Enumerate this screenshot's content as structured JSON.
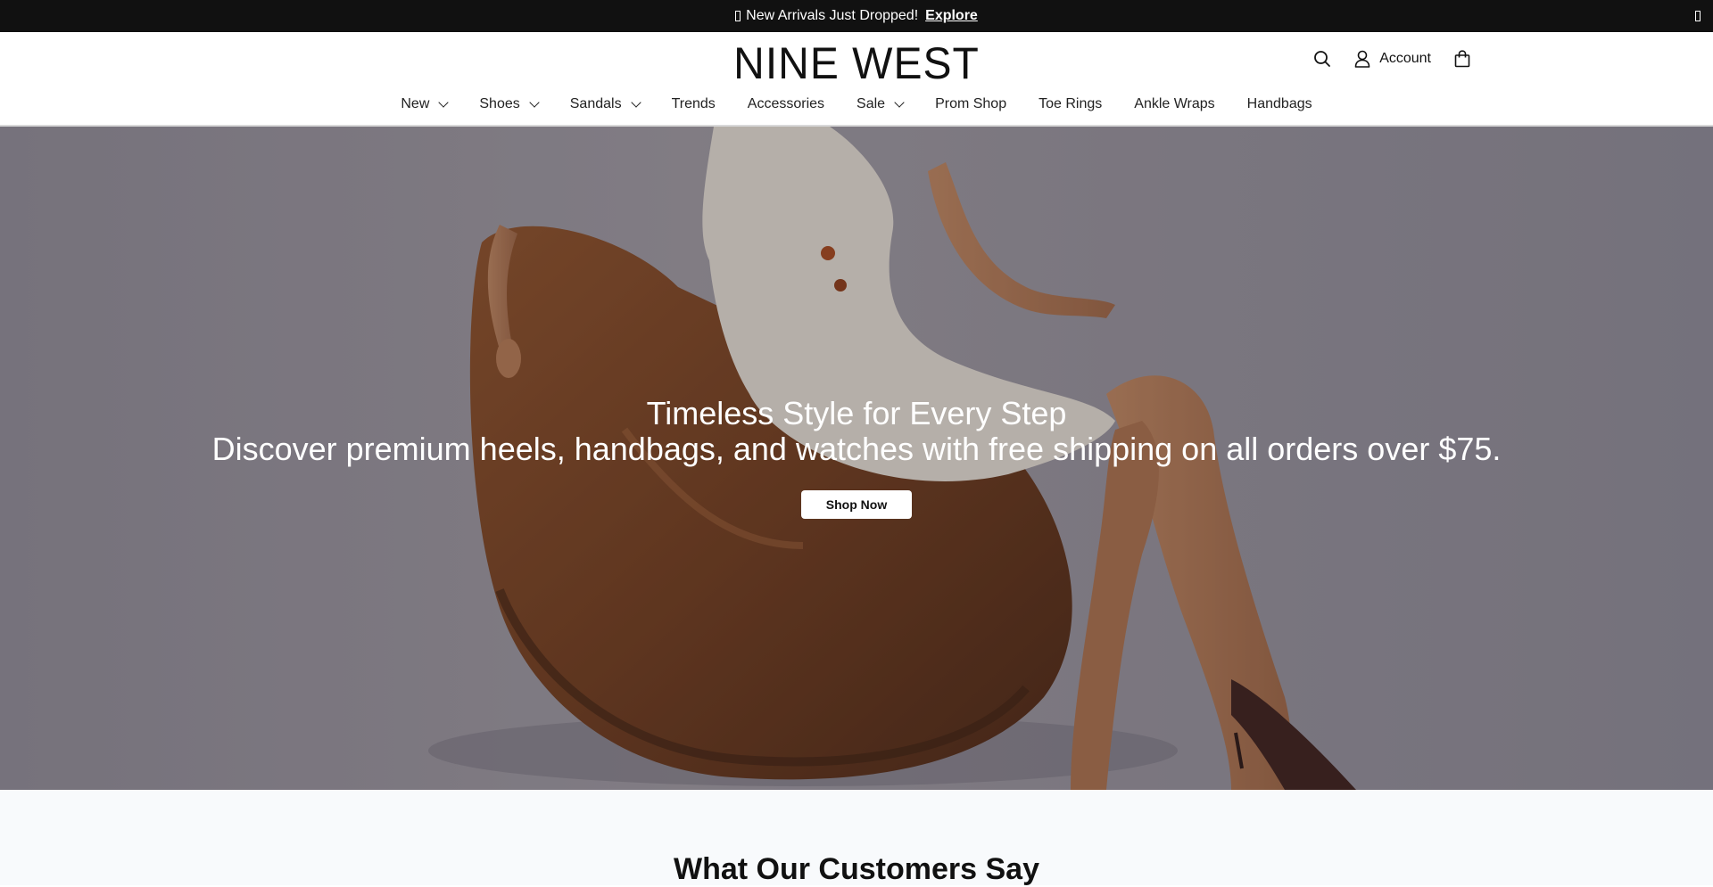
{
  "announcement": {
    "message": "New Arrivals Just Dropped!",
    "link_label": "Explore"
  },
  "header": {
    "logo": "NINE WEST",
    "account_label": "Account",
    "icons": [
      "search-icon",
      "user-icon",
      "bag-icon"
    ]
  },
  "nav": {
    "items": [
      {
        "label": "New",
        "has_dropdown": true
      },
      {
        "label": "Shoes",
        "has_dropdown": true
      },
      {
        "label": "Sandals",
        "has_dropdown": true
      },
      {
        "label": "Trends",
        "has_dropdown": false
      },
      {
        "label": "Accessories",
        "has_dropdown": false
      },
      {
        "label": "Sale",
        "has_dropdown": true
      },
      {
        "label": "Prom Shop",
        "has_dropdown": false
      },
      {
        "label": "Toe Rings",
        "has_dropdown": false
      },
      {
        "label": "Ankle Wraps",
        "has_dropdown": false
      },
      {
        "label": "Handbags",
        "has_dropdown": false
      }
    ]
  },
  "hero": {
    "title": "Timeless Style for Every Step",
    "subtitle": "Discover premium heels, handbags, and watches with free shipping on all orders over $75.",
    "cta_label": "Shop Now"
  },
  "testimonials": {
    "heading": "What Our Customers Say"
  },
  "colors": {
    "announcement_bg": "#111111",
    "testimonials_bg": "#f8fafc",
    "chair": "#7a4522"
  }
}
